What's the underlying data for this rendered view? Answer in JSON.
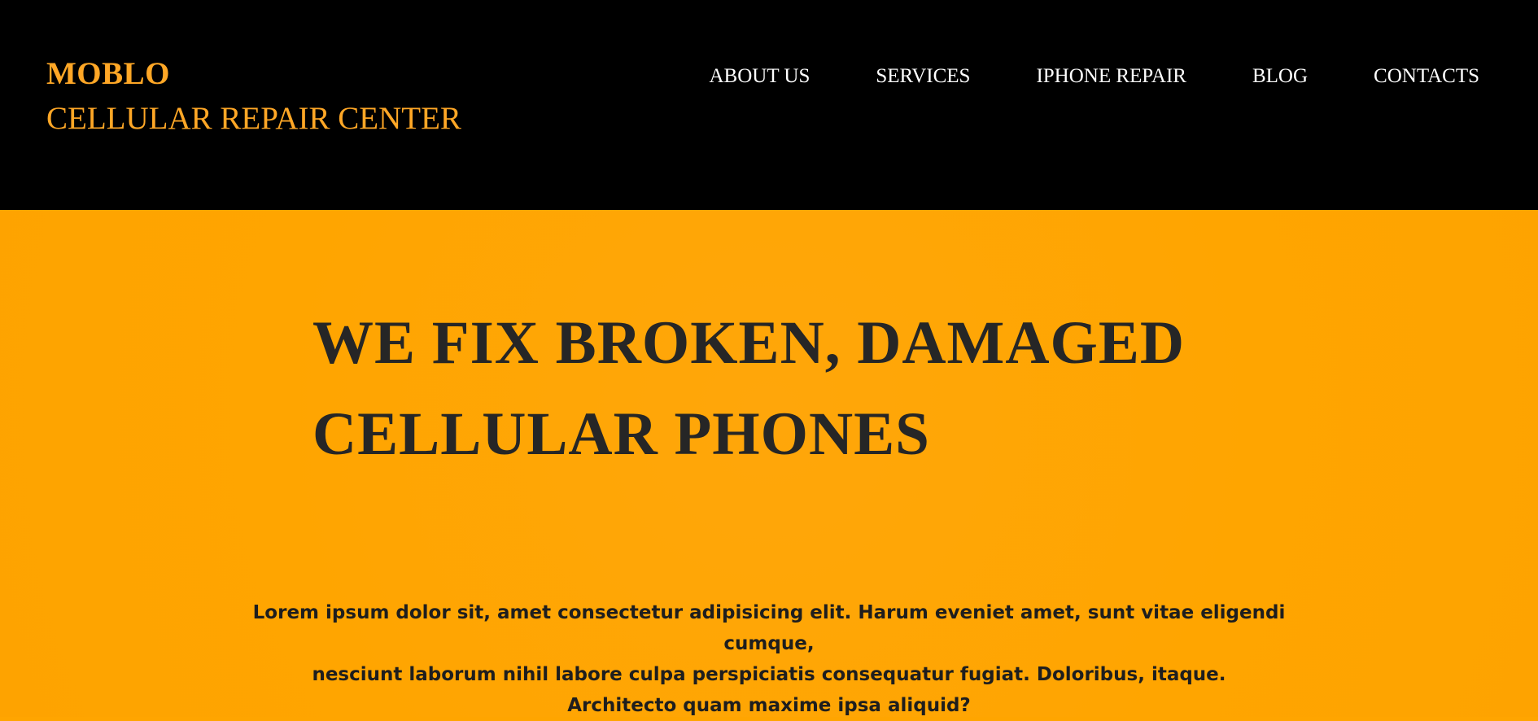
{
  "header": {
    "brand_name": "MOBLO",
    "brand_tagline": "CELLULAR REPAIR CENTER",
    "nav": [
      {
        "label": "ABOUT US"
      },
      {
        "label": "SERVICES"
      },
      {
        "label": "IPHONE REPAIR"
      },
      {
        "label": "BLOG"
      },
      {
        "label": "CONTACTS"
      }
    ]
  },
  "hero": {
    "title_line1": "WE FIX BROKEN, DAMAGED",
    "title_line2": "CELLULAR PHONES",
    "text_line1": "Lorem ipsum dolor sit, amet consectetur adipisicing elit. Harum eveniet amet, sunt vitae eligendi cumque,",
    "text_line2": "nesciunt laborum nihil labore culpa perspiciatis consequatur fugiat. Doloribus, itaque.",
    "text_line3": "Architecto quam maxime ipsa aliquid?"
  },
  "colors": {
    "header_bg": "#000000",
    "brand": "#ffa726",
    "nav_text": "#ffffff",
    "hero_bg": "#ffa500",
    "hero_text": "#262626"
  }
}
